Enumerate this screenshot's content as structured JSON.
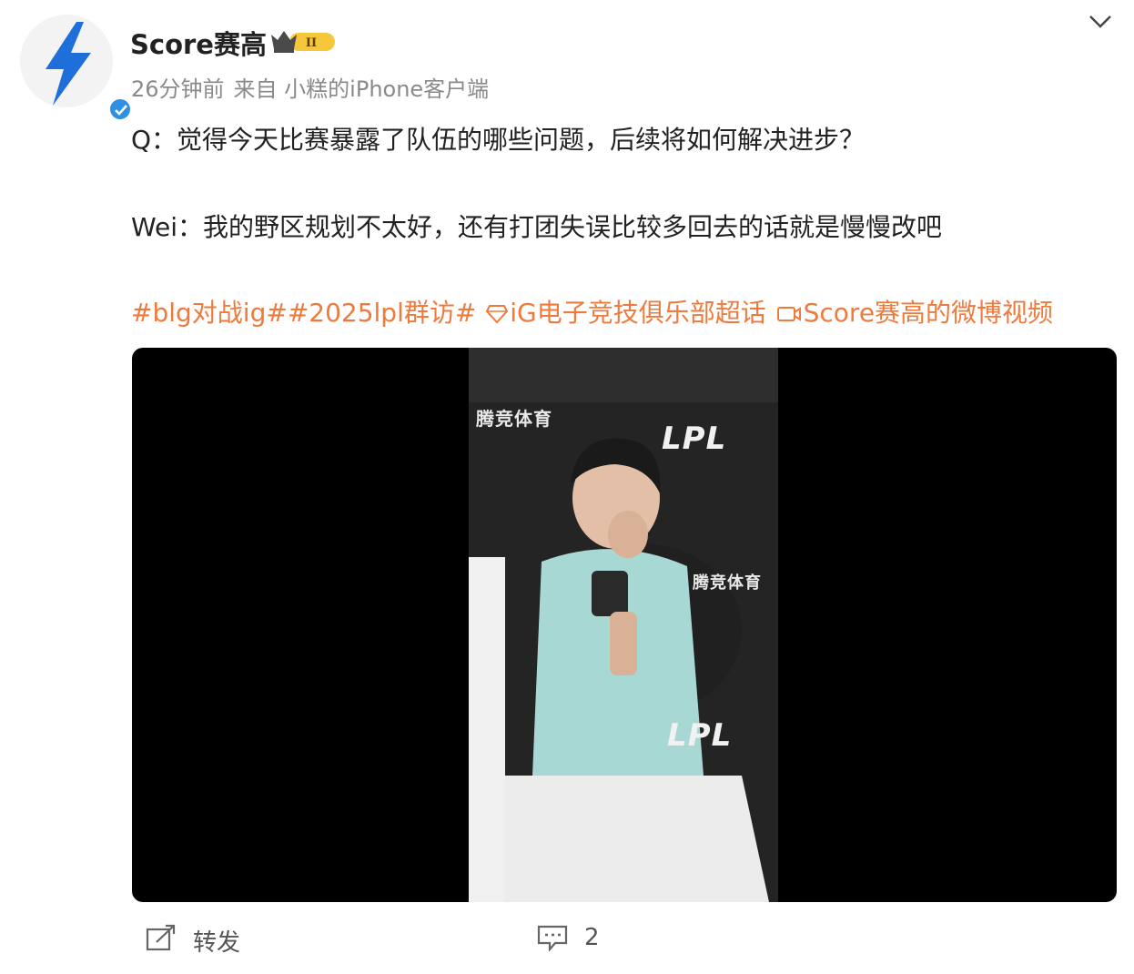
{
  "post": {
    "author": "Score赛高",
    "level_badge": "II",
    "time": "26分钟前",
    "source": "来自 小糕的iPhone客户端",
    "question": "Q：觉得今天比赛暴露了队伍的哪些问题，后续将如何解决进步？",
    "answer": "Wei：我的野区规划不太好，还有打团失误比较多回去的话就是慢慢改吧",
    "tags": {
      "tag1": "#blg对战ig#",
      "tag2": "#2025lpl群访#",
      "supertopic": "iG电子竞技俱乐部超话",
      "video_link": "Score赛高的微博视频"
    }
  },
  "video": {
    "sponsor_top": "腾竞体育",
    "sponsor_mid": "腾竞体育",
    "league_logo_top": "LPL",
    "league_logo_bottom": "LPL"
  },
  "footer": {
    "repost_label": "转发",
    "comment_count": "2"
  },
  "colors": {
    "accent_tag": "#ef7a3c",
    "verified_blue": "#2f8fe0",
    "avatar_bolt": "#1e6fd9"
  },
  "icons": [
    "bolt-logo-icon",
    "verified-icon",
    "crown-badge-icon",
    "chevron-down-icon",
    "diamond-icon",
    "video-icon",
    "repost-icon",
    "comment-icon"
  ]
}
